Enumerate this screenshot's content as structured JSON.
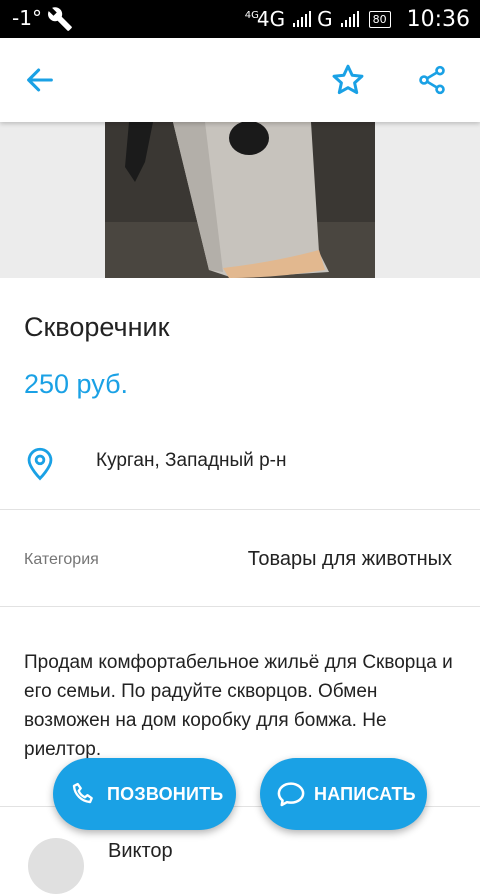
{
  "status_bar": {
    "temperature": "-1°",
    "network_small": "4G",
    "network": "4G",
    "network2": "G",
    "battery": "80",
    "time": "10:36",
    "icons": [
      "wrench-icon",
      "signal-icon",
      "battery-icon"
    ]
  },
  "toolbar": {
    "icons": [
      "back-arrow-icon",
      "star-icon",
      "share-icon"
    ],
    "accent_color": "#1aa1e5"
  },
  "listing": {
    "title": "Скворечник",
    "price": "250 руб.",
    "location": "Курган, Западный р-н",
    "category_label": "Категория",
    "category_value": "Товары для животных",
    "description": "Продам комфортабельное жильё для Скворца и его семьи. По радуйте скворцов. Обмен возможен на дом коробку для бомжа. Не риелтор."
  },
  "seller": {
    "name": "Виктор"
  },
  "actions": {
    "call_label": "ПОЗВОНИТЬ",
    "write_label": "НАПИСАТЬ"
  }
}
